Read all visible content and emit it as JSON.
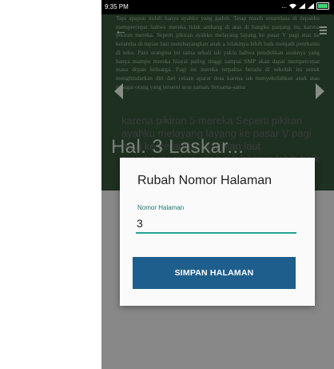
{
  "statusbar": {
    "time": "9:35 PM",
    "signal_text": "...",
    "battery_color": "#3bd56b"
  },
  "page": {
    "heading": "Hal. 3 Laskar...",
    "body_text": "Tapi apapun itulah hanya ayahku yang gaduh. Tetap masih senantiasa di depanku mempercepat bahwa mereka tidak ambang di atas di bangku panjang itu, karena pikiran mereka. Seperti pikiran ayahku melayang layang ke pasar V pagi atau ke keramba di tepian laut membayangkan anak a lelakinya lebih baik menjadi pembantu di toko. Para orangtua ini sama sekali tak yakin bahwa pendidikan anaknya yang hanya mampu mereka biayai paling tinggi sampai SMP akan dapat mempercepat masa depan keluarga. Pagi ini mereka terpaksa berada di sekolah ini untuk menghindarkan diri dari celaan aparat desa karena tak menyekolahkan anak atau sebagai orang yang terseret arus zaman, bersama-sama",
    "lower_text": "karena pikiran 5 mereka Seperti pikiran ayahku melayang layang ke pasar V pagi atau ke keramba di tepian laut membayangkan anak a lelakinya lebih baik menjadi pembantu di toko. Para"
  },
  "dialog": {
    "title": "Rubah Nomor Halaman",
    "field_label": "Nomor Halaman",
    "field_value": "3",
    "save_label": "SIMPAN HALAMAN",
    "button_color": "#1e5e8c",
    "accent_color": "#24a394"
  },
  "icons": {
    "back": "back-arrow-icon",
    "menu": "menu-icon",
    "prev": "chevron-left-icon",
    "next": "chevron-right-icon"
  }
}
